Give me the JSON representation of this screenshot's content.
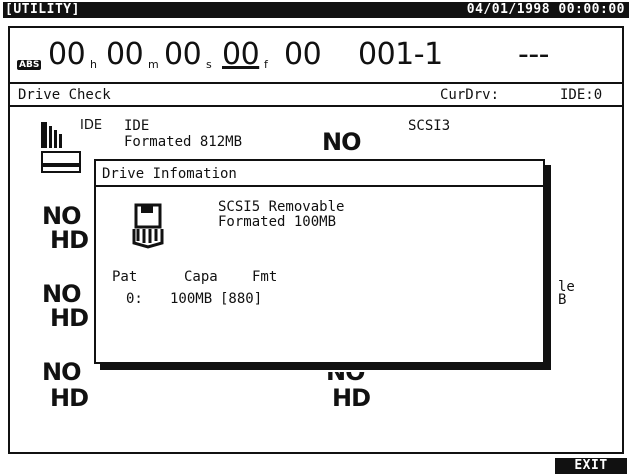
{
  "header": {
    "mode": "[UTILITY]",
    "datetime": "04/01/1998 00:00:00"
  },
  "timecode": {
    "badge": "ABS",
    "h_val": "00",
    "h_unit": "h",
    "m_val": "00",
    "m_unit": "m",
    "s_val": "00",
    "s_unit": "s",
    "f_val": "00",
    "f_unit": "f",
    "sub_val": "00",
    "marker": "001-1",
    "extra": "---"
  },
  "page": {
    "title": "Drive Check",
    "cur_drv_label": "CurDrv:",
    "cur_drv_value": "IDE:0"
  },
  "drives": {
    "ide": {
      "icon_label": "IDE",
      "name": "IDE",
      "status": "Formated 812MB"
    },
    "scsi3": {
      "status": "NO",
      "name": "SCSI3"
    },
    "left_row1": {
      "line1": "NO",
      "line2": "HD"
    },
    "left_row2": {
      "line1": "NO",
      "line2": "HD"
    },
    "left_row3": {
      "line1": "NO",
      "line2": "HD"
    },
    "right_row2": {
      "line1": "le",
      "line2": "B"
    },
    "right_row3": {
      "line1": "NO",
      "line2": "HD"
    }
  },
  "dialog": {
    "title": "Drive Infomation",
    "drive_name": "SCSI5 Removable",
    "drive_status": "Formated 100MB",
    "headers": {
      "pat": "Pat",
      "capa": "Capa",
      "fmt": "Fmt"
    },
    "row": {
      "pat": "0:",
      "capa": "100MB",
      "fmt": "[880]"
    }
  },
  "footer": {
    "exit_label": "EXIT"
  }
}
